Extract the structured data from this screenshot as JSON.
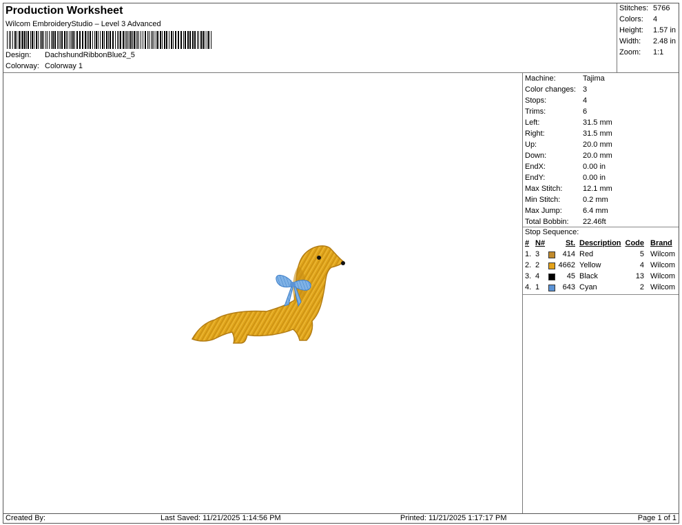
{
  "header": {
    "title": "Production Worksheet",
    "subtitle": "Wilcom EmbroideryStudio – Level 3 Advanced",
    "design_label": "Design:",
    "design_value": "DachshundRibbonBlue2_5",
    "colorway_label": "Colorway:",
    "colorway_value": "Colorway 1"
  },
  "summary": {
    "stitches_label": "Stitches:",
    "stitches_value": "5766",
    "colors_label": "Colors:",
    "colors_value": "4",
    "height_label": "Height:",
    "height_value": "1.57 in",
    "width_label": "Width:",
    "width_value": "2.48 in",
    "zoom_label": "Zoom:",
    "zoom_value": "1:1"
  },
  "info": {
    "machine_label": "Machine:",
    "machine_value": "Tajima",
    "color_changes_label": "Color changes:",
    "color_changes_value": "3",
    "stops_label": "Stops:",
    "stops_value": "4",
    "trims_label": "Trims:",
    "trims_value": "6",
    "left_label": "Left:",
    "left_value": "31.5 mm",
    "right_label": "Right:",
    "right_value": "31.5 mm",
    "up_label": "Up:",
    "up_value": "20.0 mm",
    "down_label": "Down:",
    "down_value": "20.0 mm",
    "endx_label": "EndX:",
    "endx_value": "0.00 in",
    "endy_label": "EndY:",
    "endy_value": "0.00 in",
    "max_stitch_label": "Max Stitch:",
    "max_stitch_value": "12.1 mm",
    "min_stitch_label": "Min Stitch:",
    "min_stitch_value": "0.2 mm",
    "max_jump_label": "Max Jump:",
    "max_jump_value": "6.4 mm",
    "total_bobbin_label": "Total Bobbin:",
    "total_bobbin_value": "22.46ft"
  },
  "stop_sequence": {
    "label": "Stop Sequence:",
    "headers": {
      "num": "#",
      "n": "N#",
      "st": "St.",
      "desc": "Description",
      "code": "Code",
      "brand": "Brand"
    },
    "rows": [
      {
        "num": "1.",
        "n": "3",
        "color": "#c08a2c",
        "st": "414",
        "desc": "Red",
        "code": "5",
        "brand": "Wilcom"
      },
      {
        "num": "2.",
        "n": "2",
        "color": "#e3a21a",
        "st": "4662",
        "desc": "Yellow",
        "code": "4",
        "brand": "Wilcom"
      },
      {
        "num": "3.",
        "n": "4",
        "color": "#000000",
        "st": "45",
        "desc": "Black",
        "code": "13",
        "brand": "Wilcom"
      },
      {
        "num": "4.",
        "n": "1",
        "color": "#5b93d6",
        "st": "643",
        "desc": "Cyan",
        "code": "2",
        "brand": "Wilcom"
      }
    ]
  },
  "footer": {
    "created_by": "Created By:",
    "last_saved": "Last Saved: 11/21/2025 1:14:56 PM",
    "printed": "Printed: 11/21/2025 1:17:17 PM",
    "page": "Page 1 of 1"
  }
}
